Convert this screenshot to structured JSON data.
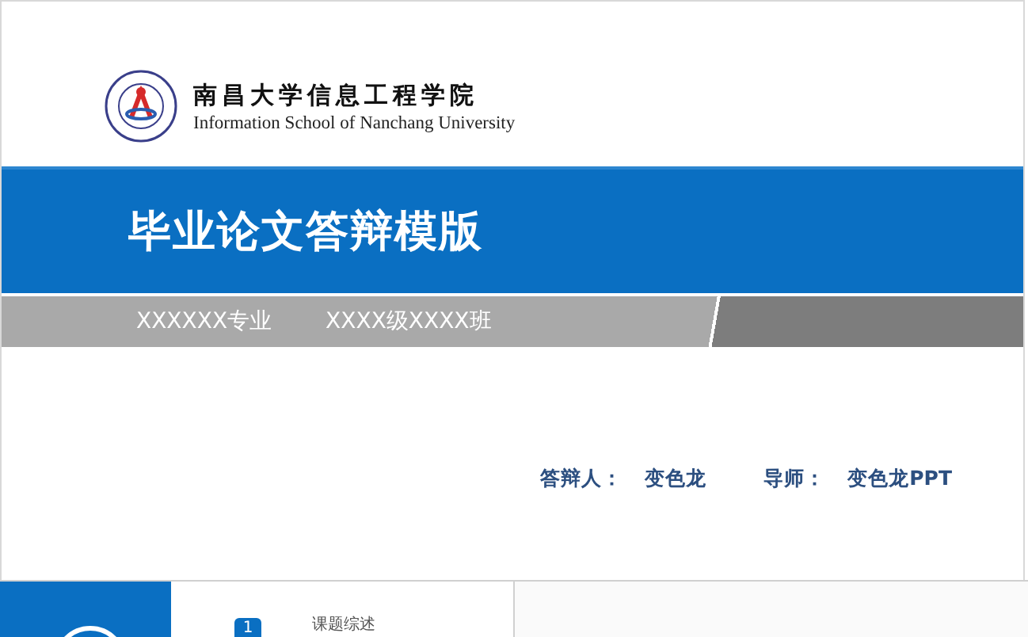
{
  "header": {
    "school_name_cn": "南昌大学信息工程学院",
    "school_name_en": "Information School of  Nanchang  University"
  },
  "title": "毕业论文答辩模版",
  "info_band": {
    "major": "XXXXXX专业",
    "class": "XXXX级XXXX班"
  },
  "presenters": [
    {
      "label": "答辩人：",
      "name": "变色龙"
    },
    {
      "label": "导师：",
      "name": "变色龙PPT"
    }
  ],
  "next_slide": {
    "number": "1",
    "item": "课题综述"
  }
}
